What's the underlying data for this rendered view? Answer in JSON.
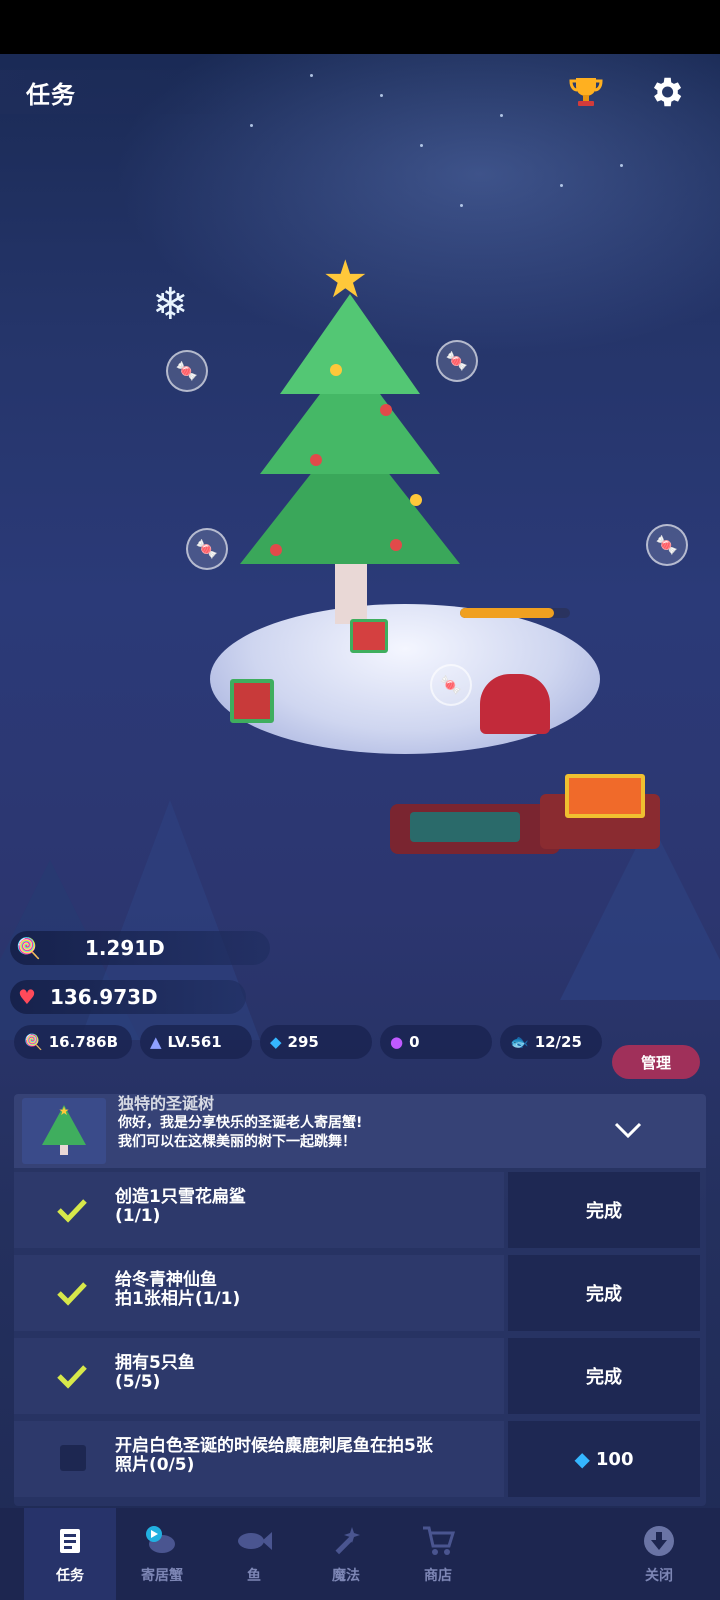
{
  "header": {
    "title": "任务"
  },
  "stats": {
    "candy": "1.291D",
    "hearts": "136.973D"
  },
  "resources": {
    "candy_total": "16.786B",
    "level": "LV.561",
    "gems": "295",
    "orbs": "0",
    "fish": "12/25",
    "manage_label": "管理"
  },
  "panel": {
    "intro_title": "独特的圣诞树",
    "intro_line1": "你好，我是分享快乐的圣诞老人寄居蟹!",
    "intro_line2": "我们可以在这棵美丽的树下一起跳舞！",
    "tasks": [
      {
        "line1": "创造1只雪花扁鲨",
        "line2": "(1/1)",
        "done": true,
        "button": "完成"
      },
      {
        "line1": "给冬青神仙鱼",
        "line2": "拍1张相片(1/1)",
        "done": true,
        "button": "完成"
      },
      {
        "line1": "拥有5只鱼",
        "line2": "(5/5)",
        "done": true,
        "button": "完成"
      },
      {
        "line1": "开启白色圣诞的时候给麋鹿刺尾鱼在拍5张",
        "line2": "照片(0/5)",
        "done": false,
        "button": "100"
      }
    ]
  },
  "nav": {
    "tasks": "任务",
    "crab": "寄居蟹",
    "fish": "鱼",
    "magic": "魔法",
    "shop": "商店",
    "close": "关闭"
  },
  "colors": {
    "accent_green": "#d7e84a",
    "manage": "#a0305a",
    "gem": "#35b6ff"
  }
}
